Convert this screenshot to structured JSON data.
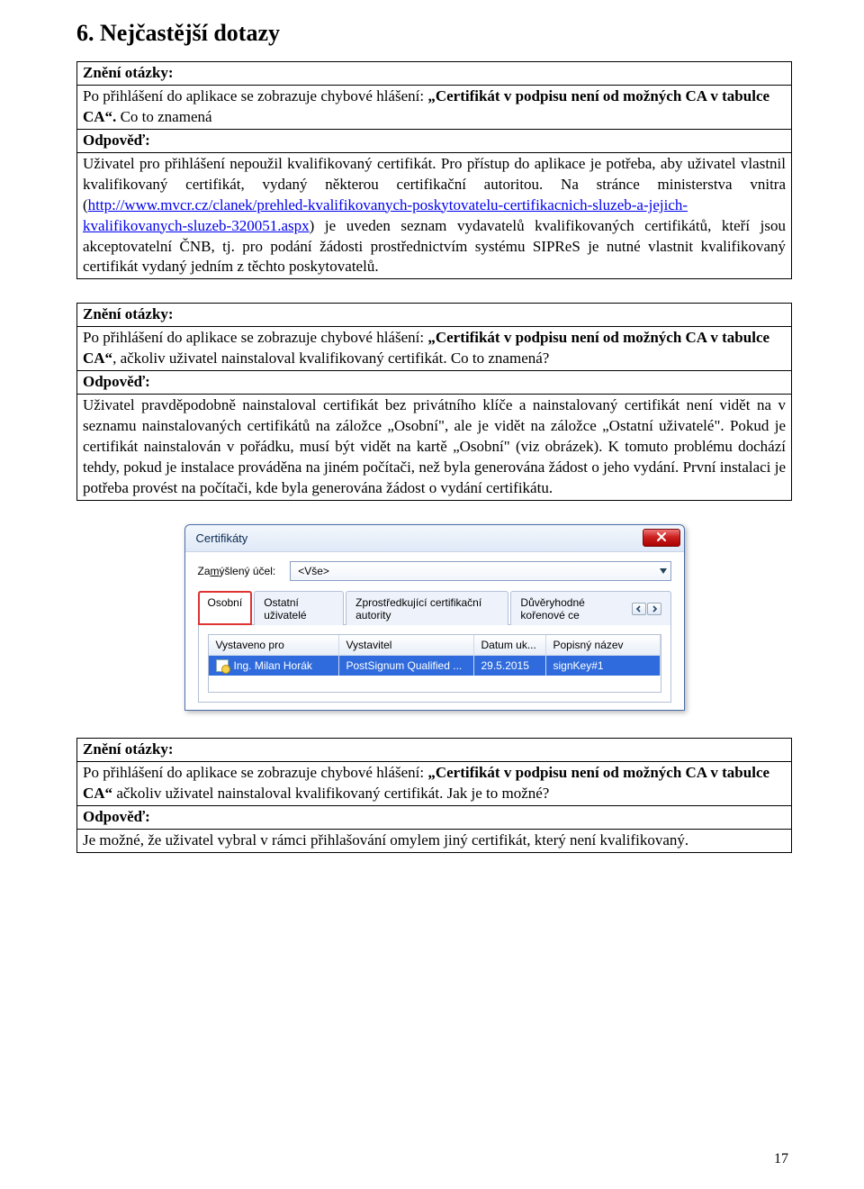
{
  "heading": "6. Nejčastější dotazy",
  "labels": {
    "question": "Znění otázky:",
    "answer": "Odpověď:"
  },
  "faq1": {
    "q_pre": "Po přihlášení do aplikace se zobrazuje chybové hlášení: ",
    "q_bold": "„Certifikát v podpisu není od možných CA v tabulce CA“.",
    "q_post": " Co to znamená",
    "a_part1": "Uživatel pro přihlášení nepoužil kvalifikovaný certifikát. Pro přístup do aplikace je potřeba, aby uživatel vlastnil kvalifikovaný certifikát, vydaný některou certifikační autoritou. Na stránce ministerstva vnitra (",
    "a_link": "http://www.mvcr.cz/clanek/prehled-kvalifikovanych-poskytovatelu-certifikacnich-sluzeb-a-jejich-kvalifikovanych-sluzeb-320051.aspx",
    "a_part2": ") je uveden seznam vydavatelů kvalifikovaných certifikátů, kteří jsou akceptovatelní ČNB, tj. pro podání žádosti prostřednictvím systému SIPReS je nutné vlastnit kvalifikovaný certifikát vydaný jedním z těchto poskytovatelů."
  },
  "faq2": {
    "q_pre": "Po přihlášení do aplikace se zobrazuje chybové hlášení: ",
    "q_bold": "„Certifikát v podpisu není od možných CA v tabulce CA“",
    "q_post": ", ačkoliv uživatel nainstaloval kvalifikovaný certifikát. Co to znamená?",
    "a": "Uživatel pravděpodobně nainstaloval certifikát bez privátního klíče a nainstalovaný certifikát není vidět na v seznamu nainstalovaných certifikátů na záložce „Osobní\", ale je vidět na záložce „Ostatní uživatelé\". Pokud je certifikát nainstalován v pořádku, musí být vidět na kartě „Osobní\" (viz obrázek). K tomuto problému dochází tehdy, pokud je instalace prováděna na jiném počítači, než byla generována žádost o jeho vydání. První instalaci je potřeba provést na počítači, kde byla generována žádost o vydání certifikátu."
  },
  "faq3": {
    "q_pre": "Po přihlášení do aplikace se zobrazuje chybové hlášení: ",
    "q_bold": "„Certifikát v podpisu není od možných CA v tabulce CA“",
    "q_post": " ačkoliv uživatel nainstaloval kvalifikovaný certifikát. Jak je to možné?",
    "a": "Je možné, že uživatel vybral v rámci přihlašování omylem jiný certifikát, který není kvalifikovaný."
  },
  "dialog": {
    "title": "Certifikáty",
    "purpose_label_pre": "Za",
    "purpose_label_u": "m",
    "purpose_label_post": "ýšlený účel:",
    "combo_value": "<Vše>",
    "tabs": {
      "t1": "Osobní",
      "t2": "Ostatní uživatelé",
      "t3": "Zprostředkující certifikační autority",
      "t4": "Důvěryhodné kořenové ce"
    },
    "columns": {
      "c1": "Vystaveno pro",
      "c2": "Vystavitel",
      "c3": "Datum uk...",
      "c4": "Popisný název"
    },
    "row": {
      "c1": "Ing. Milan Horák",
      "c2": "PostSignum Qualified ...",
      "c3": "29.5.2015",
      "c4": "signKey#1"
    }
  },
  "page_number": "17"
}
